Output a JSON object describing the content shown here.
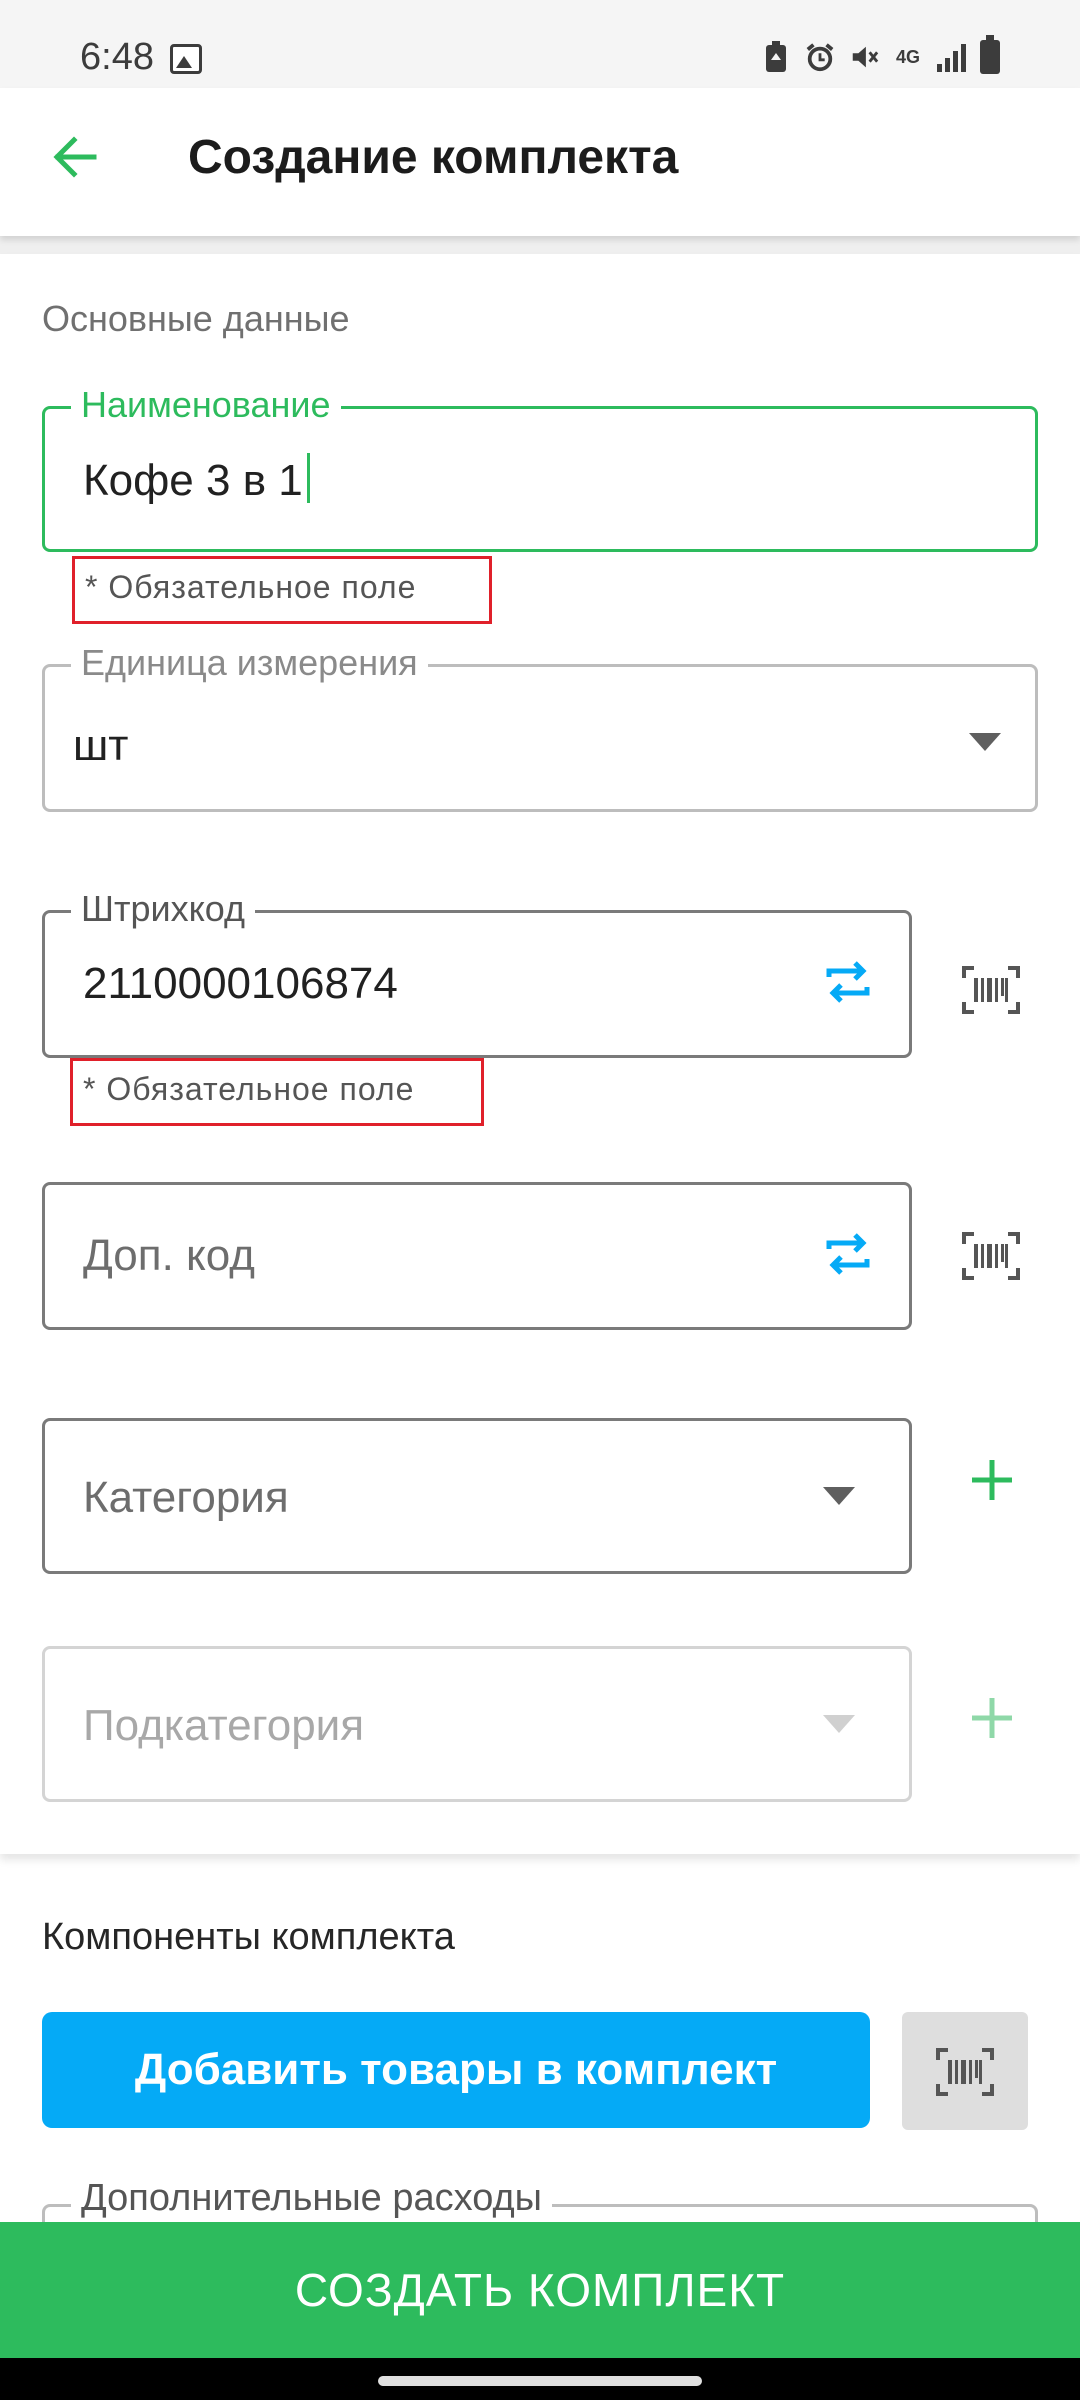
{
  "status_bar": {
    "time": "6:48",
    "network_label": "4G",
    "icons": [
      "image-icon",
      "battery-saver-icon",
      "alarm-icon",
      "mute-icon",
      "network-4g-icon",
      "signal-icon",
      "battery-icon"
    ]
  },
  "app_bar": {
    "title": "Создание комплекта",
    "back_icon": "back-arrow-icon"
  },
  "main_section": {
    "title": "Основные данные",
    "name_field": {
      "label": "Наименование",
      "value": "Кофе 3 в 1",
      "required_note": "* Обязательное поле"
    },
    "unit_field": {
      "label": "Единица измерения",
      "value": "шт"
    },
    "barcode_field": {
      "label": "Штрихкод",
      "value": "2110000106874",
      "required_note": "* Обязательное поле"
    },
    "extra_code_field": {
      "placeholder": "Доп. код"
    },
    "category_field": {
      "placeholder": "Категория"
    },
    "subcategory_field": {
      "placeholder": "Подкатегория"
    }
  },
  "components_section": {
    "title": "Компоненты комплекта",
    "add_button_label": "Добавить товары в комплект"
  },
  "extra_costs_field": {
    "label": "Дополнительные расходы"
  },
  "create_button_label": "СОЗДАТЬ КОМПЛЕКТ",
  "colors": {
    "accent_green": "#2dbb5d",
    "accent_blue": "#05aaf6",
    "error_red": "#e0202a"
  }
}
